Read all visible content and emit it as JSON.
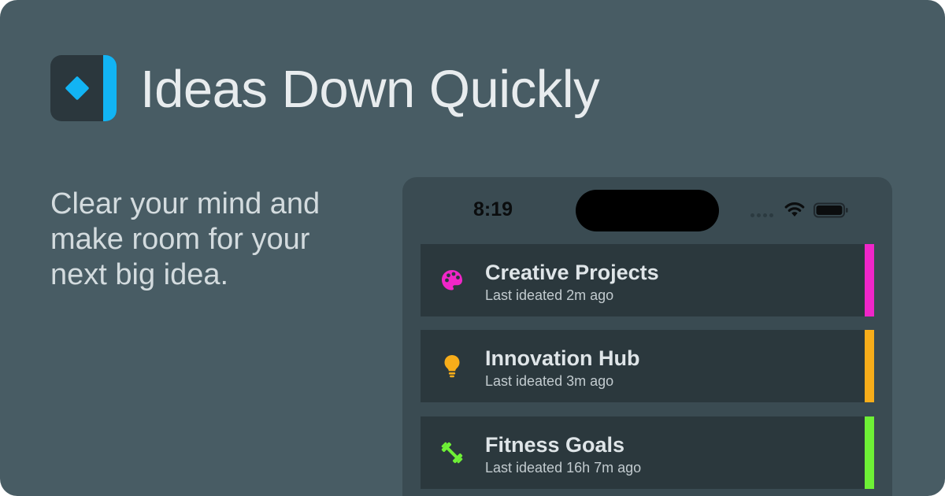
{
  "header": {
    "title": "Ideas Down Quickly",
    "logo_icon": "diamond-icon",
    "accent_color": "#12b4f4"
  },
  "tagline": "Clear your mind and make room for your next big idea.",
  "phone": {
    "status_bar": {
      "time": "8:19",
      "icons": [
        "cellular-dots-icon",
        "wifi-icon",
        "battery-icon"
      ]
    },
    "items": [
      {
        "title": "Creative Projects",
        "subtitle": "Last ideated 2m ago",
        "icon": "palette-icon",
        "color": "#f026c8"
      },
      {
        "title": "Innovation Hub",
        "subtitle": "Last ideated 3m ago",
        "icon": "lightbulb-icon",
        "color": "#f7ad1a"
      },
      {
        "title": "Fitness Goals",
        "subtitle": "Last ideated 16h 7m ago",
        "icon": "dumbbell-icon",
        "color": "#6ef036"
      }
    ]
  }
}
